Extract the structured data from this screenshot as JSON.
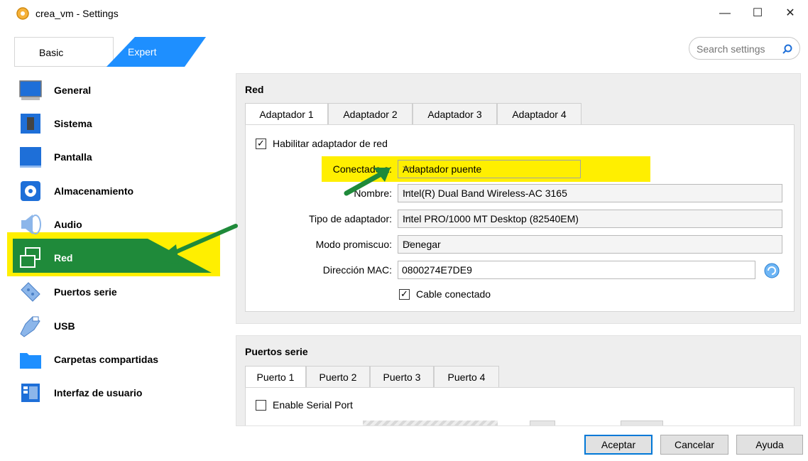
{
  "window": {
    "title": "crea_vm - Settings",
    "controls": {
      "minimize": "—",
      "maximize": "☐",
      "close": "✕"
    }
  },
  "mode_tabs": {
    "basic": "Basic",
    "expert": "Expert",
    "active": "Expert"
  },
  "search": {
    "placeholder": "Search settings"
  },
  "sidebar": {
    "active": "Red",
    "items": [
      {
        "label": "General",
        "icon": "general-monitor-icon"
      },
      {
        "label": "Sistema",
        "icon": "system-chip-icon"
      },
      {
        "label": "Pantalla",
        "icon": "display-monitor-icon"
      },
      {
        "label": "Almacenamiento",
        "icon": "storage-disk-icon"
      },
      {
        "label": "Audio",
        "icon": "speaker-icon"
      },
      {
        "label": "Red",
        "icon": "network-icon"
      },
      {
        "label": "Puertos serie",
        "icon": "serial-port-icon"
      },
      {
        "label": "USB",
        "icon": "usb-icon"
      },
      {
        "label": "Carpetas compartidas",
        "icon": "folder-icon"
      },
      {
        "label": "Interfaz de usuario",
        "icon": "user-interface-icon"
      }
    ]
  },
  "network": {
    "title": "Red",
    "tabs": [
      "Adaptador 1",
      "Adaptador 2",
      "Adaptador 3",
      "Adaptador 4"
    ],
    "active_tab": "Adaptador 1",
    "enable_label": "Habilitar adaptador de red",
    "enable_checked": true,
    "attached_label": "Conectado a:",
    "attached_value": "Adaptador puente",
    "name_label": "Nombre:",
    "name_value": "Intel(R) Dual Band Wireless-AC 3165",
    "adapter_type_label": "Tipo de adaptador:",
    "adapter_type_value": "Intel PRO/1000 MT Desktop (82540EM)",
    "promisc_label": "Modo promiscuo:",
    "promisc_value": "Denegar",
    "mac_label": "Dirección MAC:",
    "mac_value": "0800274E7DE9",
    "cable_label": "Cable conectado",
    "cable_checked": true
  },
  "serial": {
    "title": "Puertos serie",
    "tabs": [
      "Puerto 1",
      "Puerto 2",
      "Puerto 3",
      "Puerto 4"
    ],
    "active_tab": "Puerto 1",
    "enable_label": "Enable Serial Port",
    "enable_checked": false
  },
  "buttons": {
    "ok": "Aceptar",
    "cancel": "Cancelar",
    "help": "Ayuda"
  },
  "colors": {
    "highlight_yellow": "#ffef00",
    "annotation_green": "#1f8a3a",
    "expert_tab_blue": "#1e8fff",
    "primary_button_border": "#0078d7"
  }
}
